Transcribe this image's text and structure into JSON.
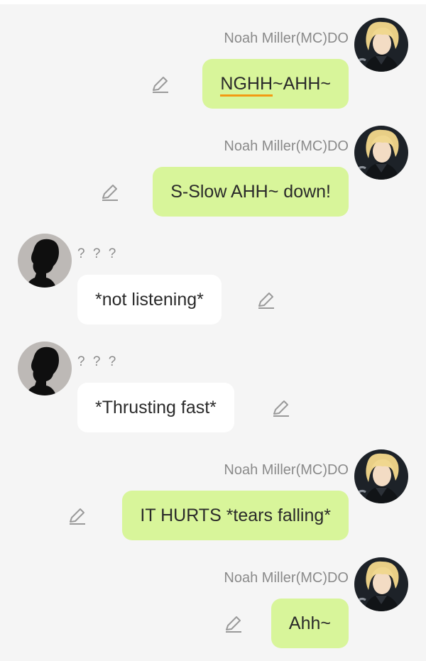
{
  "messages": [
    {
      "side": "right",
      "sender": "Noah Miller(MC)DO",
      "text_parts": [
        {
          "text": "NGHH",
          "underline": true
        },
        {
          "text": "~AHH~",
          "underline": false
        }
      ]
    },
    {
      "side": "right",
      "sender": "Noah Miller(MC)DO",
      "text_parts": [
        {
          "text": "S-Slow AHH~ down!",
          "underline": false
        }
      ]
    },
    {
      "side": "left",
      "sender": "? ? ?",
      "text_parts": [
        {
          "text": "*not listening*",
          "underline": false
        }
      ]
    },
    {
      "side": "left",
      "sender": "? ? ?",
      "text_parts": [
        {
          "text": "*Thrusting fast*",
          "underline": false
        }
      ]
    },
    {
      "side": "right",
      "sender": "Noah Miller(MC)DO",
      "text_parts": [
        {
          "text": "IT HURTS *tears falling*",
          "underline": false
        }
      ]
    },
    {
      "side": "right",
      "sender": "Noah Miller(MC)DO",
      "text_parts": [
        {
          "text": "Ahh~",
          "underline": false
        }
      ]
    }
  ],
  "icons": {
    "edit": "pencil-icon",
    "right_avatar": "blonde-character-avatar",
    "left_avatar": "silhouette-avatar"
  },
  "colors": {
    "background": "#f5f5f5",
    "right_bubble": "#d8f59a",
    "left_bubble": "#ffffff",
    "sender_name": "#8a8a8a",
    "underline": "#f39a12"
  }
}
